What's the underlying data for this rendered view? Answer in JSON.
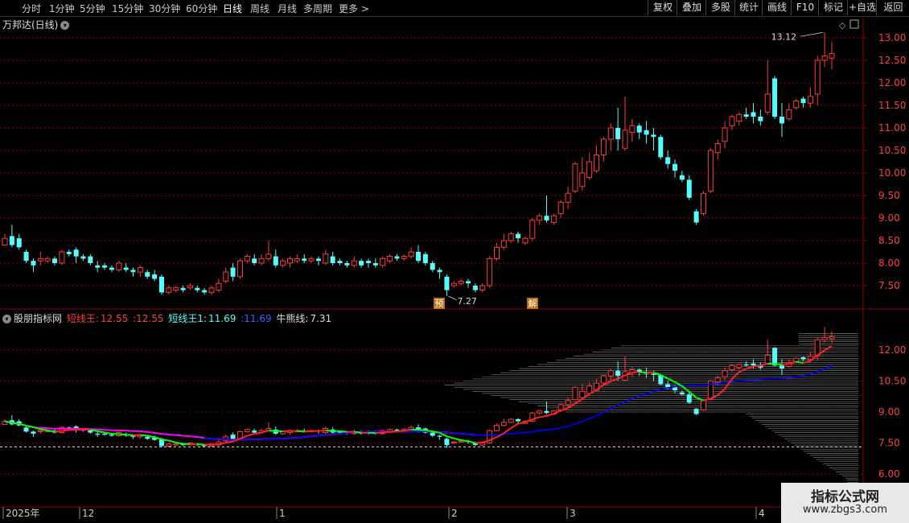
{
  "toolbar": {
    "periods": [
      "分时",
      "1分钟",
      "5分钟",
      "15分钟",
      "30分钟",
      "60分钟",
      "日线",
      "周线",
      "月线",
      "多周期",
      "更多 >"
    ],
    "active_period": "日线",
    "buttons": [
      "复权",
      "叠加",
      "多股",
      "统计",
      "画线",
      "F10",
      "标记",
      "+自选",
      "返回"
    ]
  },
  "main_chart": {
    "title": "万邦达(日线)",
    "price_axis": [
      "13.00",
      "12.50",
      "12.00",
      "11.50",
      "11.00",
      "10.50",
      "10.00",
      "9.50",
      "9.00",
      "8.50",
      "8.00",
      "7.50"
    ],
    "high_label": "13.12",
    "low_label": "7.27",
    "marker_pre": "预",
    "marker_jie": "解"
  },
  "indicator": {
    "name": "股朋指标网",
    "s1_label": "短线王:",
    "s1_value": "12.55",
    "s1_value2": ":12.55",
    "s2_label": "短线王1:",
    "s2_value": "11.69",
    "s2_value2": ":11.69",
    "s3_label": "牛熊线:",
    "s3_value": "7.31",
    "axis": [
      "12.00",
      "10.50",
      "9.00",
      "7.50",
      "6.00"
    ]
  },
  "time_axis": [
    "2025年",
    "12",
    "1",
    "2",
    "3",
    "4"
  ],
  "watermark": {
    "line1": "指标公式网",
    "line2": "www.zbgs3.com"
  },
  "colors": {
    "up": "#ff3c3c",
    "down": "#54ffff",
    "grid": "#8b0000",
    "cost_line": "#0000ff",
    "ma_magenta": "#ff00ff",
    "ma_red": "#ff2020",
    "ma_green": "#00ff00"
  },
  "candles": [
    [
      8.4,
      8.55,
      8.4,
      8.65
    ],
    [
      8.6,
      8.4,
      8.35,
      8.85
    ],
    [
      8.55,
      8.35,
      8.3,
      8.65
    ],
    [
      8.25,
      8.05,
      8.0,
      8.3
    ],
    [
      8.05,
      7.95,
      7.8,
      8.1
    ],
    [
      8.05,
      8.1,
      7.95,
      8.25
    ],
    [
      8.05,
      8.1,
      8.0,
      8.15
    ],
    [
      8.1,
      8.0,
      7.95,
      8.15
    ],
    [
      8.0,
      8.25,
      7.95,
      8.3
    ],
    [
      8.25,
      8.2,
      8.15,
      8.3
    ],
    [
      8.3,
      8.15,
      8.0,
      8.35
    ],
    [
      8.15,
      8.1,
      8.05,
      8.2
    ],
    [
      8.15,
      8.0,
      7.95,
      8.2
    ],
    [
      7.95,
      7.9,
      7.8,
      8.05
    ],
    [
      7.95,
      7.9,
      7.85,
      8.0
    ],
    [
      7.9,
      7.85,
      7.8,
      7.95
    ],
    [
      7.85,
      8.0,
      7.8,
      8.05
    ],
    [
      7.9,
      7.85,
      7.8,
      8.0
    ],
    [
      7.85,
      7.8,
      7.7,
      7.9
    ],
    [
      7.8,
      7.9,
      7.7,
      7.95
    ],
    [
      7.8,
      7.7,
      7.65,
      7.85
    ],
    [
      7.75,
      7.65,
      7.6,
      7.85
    ],
    [
      7.7,
      7.35,
      7.3,
      7.75
    ],
    [
      7.35,
      7.45,
      7.3,
      7.5
    ],
    [
      7.4,
      7.45,
      7.35,
      7.5
    ],
    [
      7.45,
      7.4,
      7.35,
      7.5
    ],
    [
      7.45,
      7.5,
      7.4,
      7.55
    ],
    [
      7.45,
      7.4,
      7.35,
      7.5
    ],
    [
      7.4,
      7.35,
      7.3,
      7.45
    ],
    [
      7.35,
      7.45,
      7.3,
      7.5
    ],
    [
      7.4,
      7.55,
      7.35,
      7.65
    ],
    [
      7.6,
      7.8,
      7.55,
      7.9
    ],
    [
      7.9,
      7.7,
      7.6,
      8.0
    ],
    [
      7.7,
      8.05,
      7.65,
      8.1
    ],
    [
      8.05,
      8.15,
      8.0,
      8.2
    ],
    [
      8.1,
      8.0,
      7.95,
      8.2
    ],
    [
      8.0,
      8.1,
      7.95,
      8.2
    ],
    [
      8.1,
      8.2,
      8.05,
      8.5
    ],
    [
      8.15,
      7.95,
      7.9,
      8.3
    ],
    [
      7.95,
      8.05,
      7.9,
      8.1
    ],
    [
      8.0,
      8.1,
      7.9,
      8.15
    ],
    [
      8.05,
      8.1,
      8.0,
      8.2
    ],
    [
      8.1,
      8.05,
      8.0,
      8.2
    ],
    [
      8.05,
      8.1,
      8.0,
      8.15
    ],
    [
      8.1,
      8.05,
      7.95,
      8.15
    ],
    [
      8.0,
      8.2,
      7.95,
      8.3
    ],
    [
      8.15,
      8.0,
      7.95,
      8.25
    ],
    [
      8.05,
      8.0,
      7.95,
      8.1
    ],
    [
      8.0,
      7.95,
      7.9,
      8.05
    ],
    [
      7.95,
      8.05,
      7.9,
      8.15
    ],
    [
      8.05,
      7.95,
      7.9,
      8.1
    ],
    [
      8.05,
      8.0,
      7.9,
      8.1
    ],
    [
      8.0,
      7.95,
      7.9,
      8.1
    ],
    [
      7.95,
      8.1,
      7.9,
      8.15
    ],
    [
      8.05,
      8.15,
      8.0,
      8.2
    ],
    [
      8.15,
      8.1,
      8.05,
      8.2
    ],
    [
      8.1,
      8.15,
      8.05,
      8.2
    ],
    [
      8.15,
      8.25,
      8.1,
      8.35
    ],
    [
      8.25,
      8.05,
      8.0,
      8.4
    ],
    [
      8.2,
      8.0,
      7.95,
      8.25
    ],
    [
      8.0,
      7.85,
      7.8,
      8.05
    ],
    [
      7.85,
      7.8,
      7.65,
      7.9
    ],
    [
      7.7,
      7.4,
      7.27,
      7.75
    ],
    [
      7.5,
      7.55,
      7.45,
      7.6
    ],
    [
      7.55,
      7.6,
      7.5,
      7.65
    ],
    [
      7.6,
      7.55,
      7.45,
      7.65
    ],
    [
      7.5,
      7.4,
      7.35,
      7.55
    ],
    [
      7.4,
      7.5,
      7.35,
      7.55
    ],
    [
      7.5,
      8.1,
      7.45,
      8.15
    ],
    [
      8.1,
      8.35,
      8.05,
      8.45
    ],
    [
      8.35,
      8.5,
      8.3,
      8.65
    ],
    [
      8.5,
      8.65,
      8.45,
      8.7
    ],
    [
      8.65,
      8.55,
      8.45,
      8.7
    ],
    [
      8.45,
      8.55,
      8.4,
      8.6
    ],
    [
      8.55,
      8.95,
      8.5,
      9.0
    ],
    [
      8.95,
      9.05,
      8.85,
      9.1
    ],
    [
      9.05,
      8.95,
      8.9,
      9.5
    ],
    [
      8.9,
      9.05,
      8.85,
      9.1
    ],
    [
      9.1,
      9.35,
      9.0,
      9.4
    ],
    [
      9.35,
      9.55,
      9.2,
      9.7
    ],
    [
      9.6,
      10.2,
      9.55,
      10.25
    ],
    [
      9.7,
      10.0,
      9.6,
      10.35
    ],
    [
      9.9,
      10.25,
      9.85,
      10.45
    ],
    [
      10.05,
      10.4,
      10.0,
      10.6
    ],
    [
      10.4,
      10.75,
      10.25,
      10.8
    ],
    [
      10.75,
      11.0,
      10.5,
      11.1
    ],
    [
      11.0,
      10.75,
      10.5,
      11.45
    ],
    [
      10.55,
      10.95,
      10.5,
      11.7
    ],
    [
      10.9,
      11.05,
      10.7,
      11.2
    ],
    [
      11.05,
      10.9,
      10.75,
      11.1
    ],
    [
      10.95,
      10.85,
      10.65,
      11.15
    ],
    [
      10.85,
      10.8,
      10.5,
      11.0
    ],
    [
      10.8,
      10.35,
      10.3,
      10.85
    ],
    [
      10.35,
      10.2,
      10.1,
      10.5
    ],
    [
      10.2,
      10.05,
      9.9,
      10.3
    ],
    [
      9.95,
      9.85,
      9.8,
      10.05
    ],
    [
      9.85,
      9.45,
      9.4,
      9.95
    ],
    [
      9.15,
      8.9,
      8.85,
      9.2
    ],
    [
      9.1,
      9.55,
      9.05,
      9.6
    ],
    [
      9.6,
      10.5,
      9.55,
      10.55
    ],
    [
      10.45,
      10.65,
      10.3,
      10.75
    ],
    [
      10.7,
      11.0,
      10.55,
      11.15
    ],
    [
      11.05,
      11.25,
      10.95,
      11.3
    ],
    [
      11.15,
      11.3,
      11.05,
      11.35
    ],
    [
      11.3,
      11.25,
      11.2,
      11.45
    ],
    [
      11.35,
      11.25,
      11.1,
      11.55
    ],
    [
      11.25,
      11.15,
      11.05,
      11.4
    ],
    [
      11.35,
      11.75,
      11.3,
      12.5
    ],
    [
      12.1,
      11.25,
      11.2,
      12.15
    ],
    [
      11.25,
      11.1,
      10.8,
      11.55
    ],
    [
      11.2,
      11.4,
      11.15,
      11.55
    ],
    [
      11.45,
      11.6,
      11.4,
      11.65
    ],
    [
      11.65,
      11.55,
      11.45,
      11.7
    ],
    [
      11.55,
      11.7,
      11.45,
      11.9
    ],
    [
      11.75,
      12.5,
      11.5,
      12.6
    ],
    [
      12.5,
      12.6,
      12.35,
      13.12
    ],
    [
      12.55,
      12.65,
      12.3,
      12.9
    ]
  ]
}
